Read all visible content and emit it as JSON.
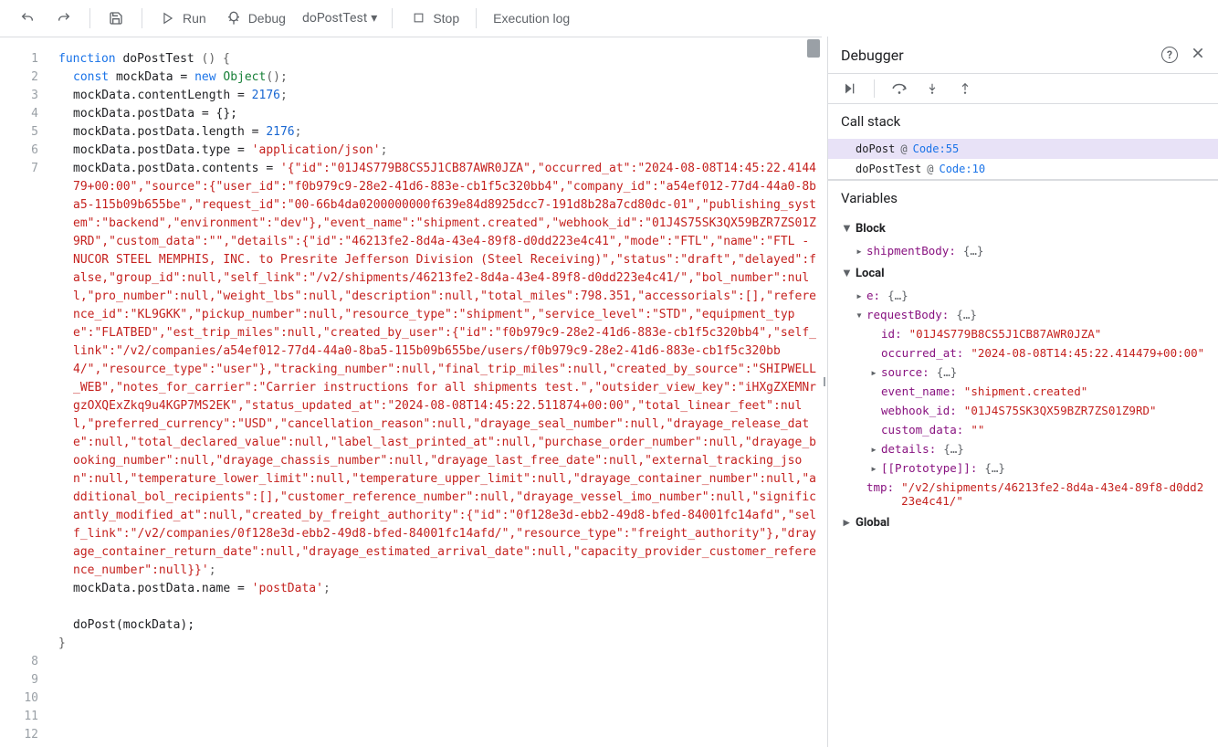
{
  "toolbar": {
    "run": "Run",
    "debug": "Debug",
    "fn_name": "doPostTest",
    "stop": "Stop",
    "exec_log": "Execution log"
  },
  "code": {
    "lines_plain": [
      "1",
      "2",
      "3",
      "4",
      "5",
      "6",
      "7",
      "8",
      "9",
      "10",
      "11",
      "12"
    ],
    "line7_wraps": 26,
    "l1_kw": "function",
    "l1_fn": "doPostTest",
    "l1_rest": " () {",
    "l2_kw": "const",
    "l2a": " mockData = ",
    "l2_new": "new",
    "l2_obj": "Object",
    "l2_end": "();",
    "l3a": "mockData.contentLength = ",
    "l3_num": "2176",
    "l3_end": ";",
    "l4": "mockData.postData = {};",
    "l5a": "mockData.postData.length = ",
    "l5_num": "2176",
    "l5_end": ";",
    "l6a": "mockData.postData.type = ",
    "l6_str": "'application/json'",
    "l6_end": ";",
    "l7a": "mockData.postData.contents = ",
    "l7_str": "'{\"id\":\"01J4S779B8CS5J1CB87AWR0JZA\",\"occurred_at\":\"2024-08-08T14:45:22.414479+00:00\",\"source\":{\"user_id\":\"f0b979c9-28e2-41d6-883e-cb1f5c320bb4\",\"company_id\":\"a54ef012-77d4-44a0-8ba5-115b09b655be\",\"request_id\":\"00-66b4da0200000000f639e84d8925dcc7-191d8b28a7cd80dc-01\",\"publishing_system\":\"backend\",\"environment\":\"dev\"},\"event_name\":\"shipment.created\",\"webhook_id\":\"01J4S75SK3QX59BZR7ZS01Z9RD\",\"custom_data\":\"\",\"details\":{\"id\":\"46213fe2-8d4a-43e4-89f8-d0dd223e4c41\",\"mode\":\"FTL\",\"name\":\"FTL - NUCOR STEEL MEMPHIS, INC. to Presrite Jefferson Division (Steel Receiving)\",\"status\":\"draft\",\"delayed\":false,\"group_id\":null,\"self_link\":\"/v2/shipments/46213fe2-8d4a-43e4-89f8-d0dd223e4c41/\",\"bol_number\":null,\"pro_number\":null,\"weight_lbs\":null,\"description\":null,\"total_miles\":798.351,\"accessorials\":[],\"reference_id\":\"KL9GKK\",\"pickup_number\":null,\"resource_type\":\"shipment\",\"service_level\":\"STD\",\"equipment_type\":\"FLATBED\",\"est_trip_miles\":null,\"created_by_user\":{\"id\":\"f0b979c9-28e2-41d6-883e-cb1f5c320bb4\",\"self_link\":\"/v2/companies/a54ef012-77d4-44a0-8ba5-115b09b655be/users/f0b979c9-28e2-41d6-883e-cb1f5c320bb4/\",\"resource_type\":\"user\"},\"tracking_number\":null,\"final_trip_miles\":null,\"created_by_source\":\"SHIPWELL_WEB\",\"notes_for_carrier\":\"Carrier instructions for all shipments test.\",\"outsider_view_key\":\"iHXgZXEMNrgzOXQExZkq9u4KGP7MS2EK\",\"status_updated_at\":\"2024-08-08T14:45:22.511874+00:00\",\"total_linear_feet\":null,\"preferred_currency\":\"USD\",\"cancellation_reason\":null,\"drayage_seal_number\":null,\"drayage_release_date\":null,\"total_declared_value\":null,\"label_last_printed_at\":null,\"purchase_order_number\":null,\"drayage_booking_number\":null,\"drayage_chassis_number\":null,\"drayage_last_free_date\":null,\"external_tracking_json\":null,\"temperature_lower_limit\":null,\"temperature_upper_limit\":null,\"drayage_container_number\":null,\"additional_bol_recipients\":[],\"customer_reference_number\":null,\"drayage_vessel_imo_number\":null,\"significantly_modified_at\":null,\"created_by_freight_authority\":{\"id\":\"0f128e3d-ebb2-49d8-bfed-84001fc14afd\",\"self_link\":\"/v2/companies/0f128e3d-ebb2-49d8-bfed-84001fc14afd/\",\"resource_type\":\"freight_authority\"},\"drayage_container_return_date\":null,\"drayage_estimated_arrival_date\":null,\"capacity_provider_customer_reference_number\":null}}'",
    "l7_end": ";",
    "l8a": "mockData.postData.name = ",
    "l8_str": "'postData'",
    "l8_end": ";",
    "l10": "doPost(mockData);",
    "l11": "}"
  },
  "debugger": {
    "title": "Debugger",
    "callstack_title": "Call stack",
    "vars_title": "Variables",
    "stack": [
      {
        "fn": "doPost",
        "at": "@",
        "loc": "Code:55"
      },
      {
        "fn": "doPostTest",
        "at": "@",
        "loc": "Code:10"
      }
    ],
    "scopes": {
      "block": "Block",
      "local": "Local",
      "global": "Global"
    },
    "block_vars": {
      "shipmentBody": "{…}"
    },
    "local_vars": {
      "e": "{…}",
      "requestBody": "{…}",
      "id": "\"01J4S779B8CS5J1CB87AWR0JZA\"",
      "occurred_at": "\"2024-08-08T14:45:22.414479+00:00\"",
      "source": "{…}",
      "event_name": "\"shipment.created\"",
      "webhook_id": "\"01J4S75SK3QX59BZR7ZS01Z9RD\"",
      "custom_data": "\"\"",
      "details": "{…}",
      "prototype_lbl": "[[Prototype]]",
      "prototype": "{…}",
      "tmp": "\"/v2/shipments/46213fe2-8d4a-43e4-89f8-d0dd223e4c41/\""
    }
  }
}
